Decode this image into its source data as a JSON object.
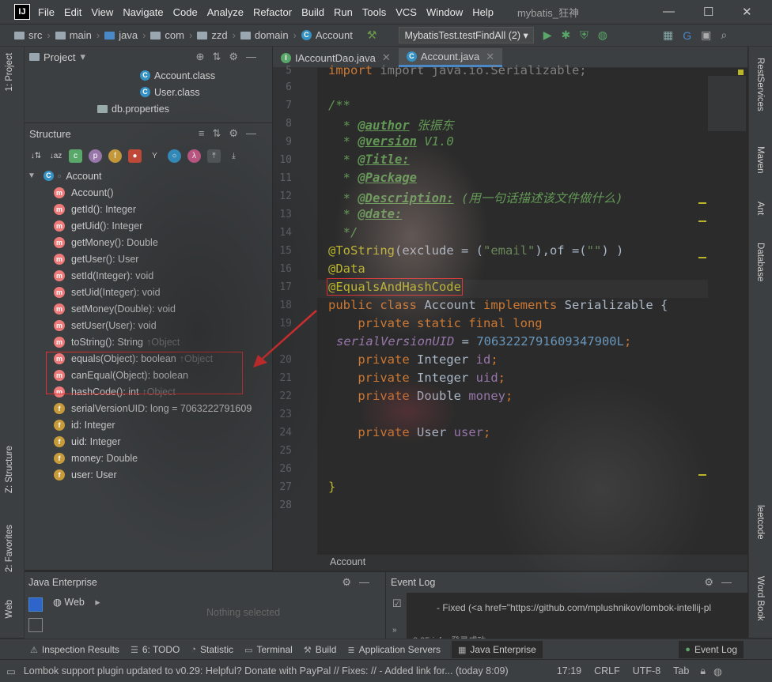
{
  "app": {
    "logo": "IJ",
    "menu": [
      "File",
      "Edit",
      "View",
      "Navigate",
      "Code",
      "Analyze",
      "Refactor",
      "Build",
      "Run",
      "Tools",
      "VCS",
      "Window",
      "Help"
    ],
    "window_title": "mybatis_狂神",
    "controls": {
      "minimize": "—",
      "maximize": "☐",
      "close": "✕"
    }
  },
  "breadcrumb": [
    "src",
    "main",
    "java",
    "com",
    "zzd",
    "domain",
    "Account"
  ],
  "run_config": "MybatisTest.testFindAll (2)",
  "left_tools": {
    "project": "1: Project",
    "structure": "Z: Structure",
    "favorites": "2: Favorites",
    "web": "Web"
  },
  "project_panel": {
    "title": "Project",
    "items": [
      "Account.class",
      "User.class",
      "db.properties"
    ]
  },
  "structure_panel": {
    "title": "Structure",
    "root": "Account",
    "members": [
      {
        "kind": "m",
        "text": "Account()",
        "inherit": ""
      },
      {
        "kind": "m",
        "text": "getId(): Integer",
        "inherit": ""
      },
      {
        "kind": "m",
        "text": "getUid(): Integer",
        "inherit": ""
      },
      {
        "kind": "m",
        "text": "getMoney(): Double",
        "inherit": ""
      },
      {
        "kind": "m",
        "text": "getUser(): User",
        "inherit": ""
      },
      {
        "kind": "m",
        "text": "setId(Integer): void",
        "inherit": ""
      },
      {
        "kind": "m",
        "text": "setUid(Integer): void",
        "inherit": ""
      },
      {
        "kind": "m",
        "text": "setMoney(Double): void",
        "inherit": ""
      },
      {
        "kind": "m",
        "text": "setUser(User): void",
        "inherit": ""
      },
      {
        "kind": "m",
        "text": "toString(): String",
        "inherit": "↑Object"
      },
      {
        "kind": "m",
        "text": "equals(Object): boolean",
        "inherit": "↑Object"
      },
      {
        "kind": "m",
        "text": "canEqual(Object): boolean",
        "inherit": ""
      },
      {
        "kind": "m",
        "text": "hashCode(): int",
        "inherit": "↑Object"
      },
      {
        "kind": "f",
        "text": "serialVersionUID: long = 7063222791609",
        "inherit": ""
      },
      {
        "kind": "f",
        "text": "id: Integer",
        "inherit": ""
      },
      {
        "kind": "f",
        "text": "uid: Integer",
        "inherit": ""
      },
      {
        "kind": "f",
        "text": "money: Double",
        "inherit": ""
      },
      {
        "kind": "f",
        "text": "user: User",
        "inherit": ""
      }
    ]
  },
  "editor": {
    "tabs": [
      "IAccountDao.java",
      "Account.java"
    ],
    "active_tab": "Account.java",
    "line_numbers": [
      "5",
      "6",
      "7",
      "8",
      "9",
      "10",
      "11",
      "12",
      "13",
      "14",
      "15",
      "16",
      "17",
      "18",
      "19",
      "",
      "20",
      "21",
      "22",
      "23",
      "24",
      "25",
      "26",
      "27",
      "28"
    ],
    "code": {
      "l5": "import java.io.Serializable;",
      "l7": "/**",
      "l8_tag": "@author",
      "l8_txt": "张振东",
      "l9_tag": "@version",
      "l9_txt": "V1.0",
      "l10_tag": "@Title:",
      "l11_tag": "@Package",
      "l12_tag": "@Description:",
      "l12_txt": "(用一句话描述该文件做什么)",
      "l13_tag": "@date:",
      "l14": "*/",
      "l15_ann": "@ToString",
      "l15_a": "(exclude = (",
      "l15_s1": "\"email\"",
      "l15_b": "),of =(",
      "l15_s2": "\"\"",
      "l15_c": ") )",
      "l16": "@Data",
      "l17": "@EqualsAndHashCode",
      "l18_kw1": "public class",
      "l18_name": "Account",
      "l18_kw2": "implements",
      "l18_iface": "Serializable {",
      "l19_kw": "private static final long",
      "l19b_name": "serialVersionUID",
      "l19b_eq": " = ",
      "l19b_num": "7063222791609347900L",
      "l20_kw": "private",
      "l20_type": "Integer",
      "l20_name": "id",
      "l21_kw": "private",
      "l21_type": "Integer",
      "l21_name": "uid",
      "l22_kw": "private",
      "l22_type": "Double",
      "l22_name": "money",
      "l24_kw": "private",
      "l24_type": "User",
      "l24_name": "user",
      "l27": "}"
    },
    "footer": "Account"
  },
  "right_tools": [
    "RestServices",
    "Maven",
    "Ant",
    "Database",
    "leetcode",
    "Word Book"
  ],
  "java_enterprise": {
    "title": "Java Enterprise",
    "item": "Web",
    "empty": "Nothing selected"
  },
  "event_log": {
    "title": "Event Log",
    "line1": "- Fixed (<a href=\"https://github.com/mplushnikov/lombok-intellij-pl",
    "line2": "8:25  info: 登录成功"
  },
  "bottom_tabs": [
    "Inspection Results",
    "6: TODO",
    "Statistic",
    "Terminal",
    "Build",
    "Application Servers",
    "Java Enterprise",
    "Event Log"
  ],
  "status": {
    "message": "Lombok support plugin updated to v0.29: Helpful? Donate with PayPal // Fixes: // - Added link for... (today 8:09)",
    "position": "17:19",
    "line_sep": "CRLF",
    "encoding": "UTF-8",
    "indent": "Tab"
  },
  "colors": {
    "accent": "#4a88c7",
    "annotation_box": "#e03030"
  }
}
